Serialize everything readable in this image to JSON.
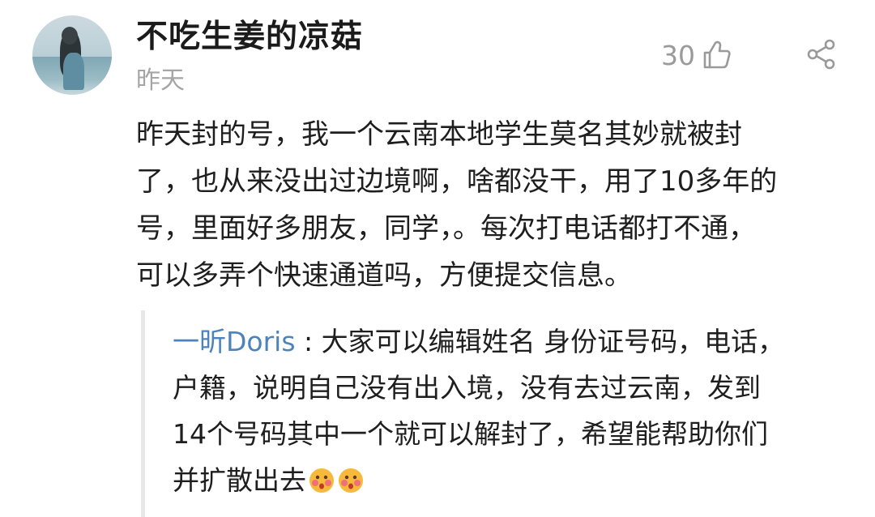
{
  "comment": {
    "username": "不吃生姜的凉菇",
    "time": "昨天",
    "like_count": "30",
    "body_lines": [
      "昨天封的号，我一个云南本地学生莫名其妙就被封",
      "了，也从来没出过边境啊，啥都没干，用了10多年的",
      "号，里面好多朋友，同学，。每次打电话都打不通，",
      "可以多弄个快速通道吗，方便提交信息。"
    ]
  },
  "reply": {
    "author": "一昕Doris",
    "separator": " : ",
    "lines": [
      "大家可以编辑姓名 身份证号码，电话，",
      "户籍，说明自己没有出入境，没有去过云南，发到",
      "14个号码其中一个就可以解封了，希望能帮助你们",
      "并扩散出去"
    ],
    "emojis": [
      "blushing-face-emoji",
      "blushing-face-emoji"
    ]
  },
  "icons": {
    "like": "thumbs-up-icon",
    "share": "share-icon",
    "avatar": "user-avatar"
  },
  "colors": {
    "username": "#1b1b1b",
    "meta_gray": "#a5a5a5",
    "reply_author_blue": "#4d83b9",
    "reply_border": "#e8e8e8"
  }
}
